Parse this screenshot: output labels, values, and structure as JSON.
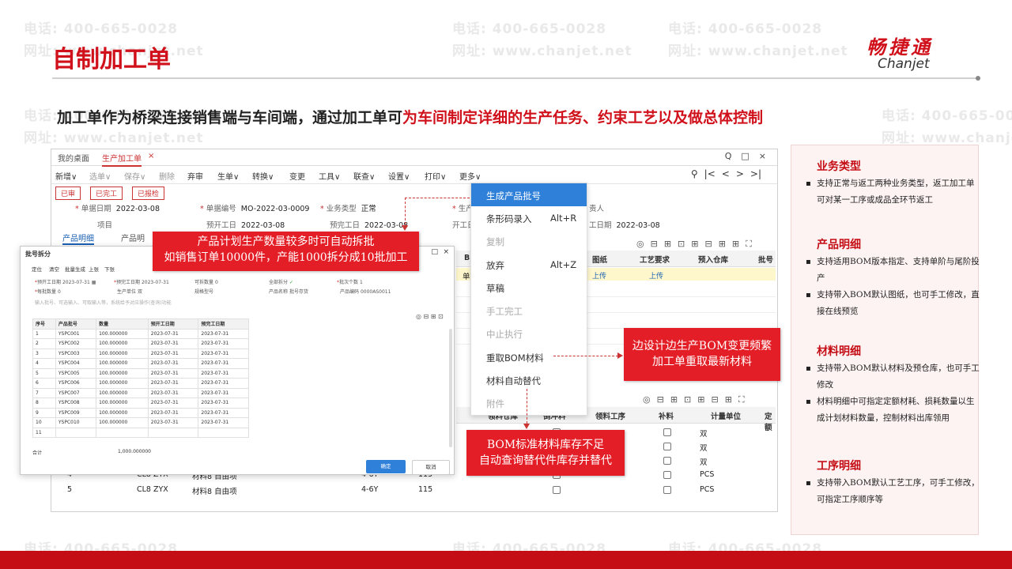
{
  "watermark": {
    "phone": "电话: 400-665-0028",
    "web": "网址: www.chanjet.net"
  },
  "slide": {
    "title": "自制加工单",
    "logo_cn": "畅捷通",
    "logo_en": "Chanjet",
    "subtitle_a": "加工单作为桥梁连接销售端与车间端，通过加工单可",
    "subtitle_b": "为车间制定详细的生产任务、约束工艺以及做总体控制"
  },
  "app": {
    "tabs": [
      "我的桌面",
      "生产加工单"
    ],
    "tab_close": "×",
    "window_tools": [
      "Q",
      "□",
      "×"
    ],
    "toolbar": [
      "新增∨",
      "选单∨",
      "保存∨",
      "删除",
      "弃审",
      "生单∨",
      "转换∨",
      "变更",
      "工具∨",
      "联查∨",
      "设置∨",
      "打印∨",
      "更多∨"
    ],
    "nav_tools": [
      "⚲",
      "|<",
      "<",
      ">",
      ">|"
    ],
    "status_buttons": [
      "已审",
      "已完工",
      "已报检"
    ],
    "form": {
      "doc_date_label": "单据日期",
      "doc_date": "2022-03-08",
      "doc_no_label": "单据编号",
      "doc_no": "MO-2022-03-0009",
      "biz_type_label": "业务类型",
      "biz_type": "正常",
      "prod_label": "生产",
      "project_label": "项目",
      "plan_start_label": "预开工日",
      "plan_start": "2022-03-08",
      "plan_finish_label": "预完工日",
      "plan_finish": "2022-03-08",
      "start_label": "开工日",
      "owner_label": "责人",
      "finish_date_label": "工日期",
      "finish_date": "2022-03-08"
    },
    "section_tabs": [
      "产品明细",
      "产品明"
    ],
    "grid_icons": [
      "◎",
      "⊟",
      "⊞",
      "⊡",
      "⊞",
      "⊟",
      "⊞",
      "⊞",
      "⛶"
    ],
    "grid_header": [
      "B",
      "图纸",
      "工艺要求",
      "预入仓库",
      "批号"
    ],
    "grid_row1_prefix": "单",
    "grid_row1_upload": [
      "上传",
      "上传"
    ],
    "grid2_header": [
      "领料仓库",
      "倒冲料",
      "领料工序",
      "补料",
      "计量单位",
      "定额"
    ],
    "grid2_units": [
      "双",
      "双",
      "双",
      "PCS",
      "PCS"
    ],
    "grid2_rows": [
      {
        "no": "4",
        "code": "CL8 ZYX",
        "name": "材料8 自由项",
        "spec": "4-6Y",
        "qty": "115"
      },
      {
        "no": "5",
        "code": "CL8 ZYX",
        "name": "材料8 自由项",
        "spec": "4-6Y",
        "qty": "115"
      }
    ]
  },
  "menu": {
    "items": [
      {
        "label": "生成产品批号",
        "key": "",
        "state": "active"
      },
      {
        "label": "条形码录入",
        "key": "Alt+R",
        "state": "normal"
      },
      {
        "label": "复制",
        "key": "",
        "state": "disabled"
      },
      {
        "label": "放弃",
        "key": "Alt+Z",
        "state": "normal"
      },
      {
        "label": "草稿",
        "key": "",
        "state": "normal"
      },
      {
        "label": "手工完工",
        "key": "",
        "state": "disabled"
      },
      {
        "label": "中止执行",
        "key": "",
        "state": "disabled"
      },
      {
        "label": "重取BOM材料",
        "key": "",
        "state": "normal"
      },
      {
        "label": "材料自动替代",
        "key": "",
        "state": "normal"
      },
      {
        "label": "附件",
        "key": "",
        "state": "disabled"
      }
    ]
  },
  "dialog": {
    "title": "批号拆分",
    "toolbar": [
      "定位",
      "清空",
      "批量生成",
      "上张",
      "下张"
    ],
    "fields": {
      "plan_start_label": "预开工日期",
      "plan_start": "2023-07-31",
      "plan_finish_label": "预完工日期",
      "plan_finish": "2023-07-31",
      "split_qty_label": "可拆数量",
      "split_qty": "0",
      "split_all_label": "全部拆分",
      "split_all": "✓",
      "batch_count_label": "批次个数",
      "batch_count": "1",
      "per_batch_label": "每批数量",
      "per_batch": "0",
      "unit_label": "生产单位",
      "unit": "双",
      "spec_label": "规格型号",
      "product_label": "产品名称",
      "product_value": "批号存货",
      "code_label": "产品编码",
      "code": "0000AS0011",
      "placeholder": "输入批号、可选输入、可取输入等，系统给予对应操作(查询)功能"
    },
    "table_header": [
      "序号",
      "产品批号",
      "数量",
      "预开工日期",
      "预完工日期"
    ],
    "rows": [
      {
        "no": "1",
        "lot": "YSPC001",
        "qty": "100.000000",
        "start": "2023-07-31",
        "end": "2023-07-31"
      },
      {
        "no": "2",
        "lot": "YSPC002",
        "qty": "100.000000",
        "start": "2023-07-31",
        "end": "2023-07-31"
      },
      {
        "no": "3",
        "lot": "YSPC003",
        "qty": "100.000000",
        "start": "2023-07-31",
        "end": "2023-07-31"
      },
      {
        "no": "4",
        "lot": "YSPC004",
        "qty": "100.000000",
        "start": "2023-07-31",
        "end": "2023-07-31"
      },
      {
        "no": "5",
        "lot": "YSPC005",
        "qty": "100.000000",
        "start": "2023-07-31",
        "end": "2023-07-31"
      },
      {
        "no": "6",
        "lot": "YSPC006",
        "qty": "100.000000",
        "start": "2023-07-31",
        "end": "2023-07-31"
      },
      {
        "no": "7",
        "lot": "YSPC007",
        "qty": "100.000000",
        "start": "2023-07-31",
        "end": "2023-07-31"
      },
      {
        "no": "8",
        "lot": "YSPC008",
        "qty": "100.000000",
        "start": "2023-07-31",
        "end": "2023-07-31"
      },
      {
        "no": "9",
        "lot": "YSPC009",
        "qty": "100.000000",
        "start": "2023-07-31",
        "end": "2023-07-31"
      },
      {
        "no": "10",
        "lot": "YSPC010",
        "qty": "100.000000",
        "start": "2023-07-31",
        "end": "2023-07-31"
      },
      {
        "no": "11",
        "lot": "",
        "qty": "",
        "start": "",
        "end": ""
      }
    ],
    "total_label": "合计",
    "total_value": "1,000.000000",
    "ok_label": "确定",
    "cancel_label": "取消"
  },
  "callouts": {
    "c1_line1": "产品计划生产数量较多时可自动拆批",
    "c1_line2": "如销售订单10000件，产能1000拆分成10批加工",
    "c2_line1": "边设计边生产BOM变更频繁",
    "c2_line2": "加工单重取最新材料",
    "c3_line1": "BOM标准材料库存不足",
    "c3_line2": "自动查询替代件库存并替代"
  },
  "panel": {
    "h1": "业务类型",
    "b1": "支持正常与返工两种业务类型，返工加工单可对某一工序或成品全环节返工",
    "h2": "产品明细",
    "b2a": "支持适用BOM版本指定、支持单阶与尾阶投产",
    "b2b": "支持带入BOM默认图纸，也可手工修改，直接在线预览",
    "h3": "材料明细",
    "b3a": "支持带入BOM默认材料及预仓库，也可手工修改",
    "b3b": "材料明细中可指定定额材耗、损耗数量以生成计划材料数量，控制材料出库领用",
    "h4": "工序明细",
    "b4": "支持带入BOM默认工艺工序，可手工修改，可指定工序顺序等"
  },
  "colors": {
    "brand_red": "#d0101a",
    "bar_red": "#c40d14",
    "menu_active": "#2f80d9",
    "callout": "#e41e26"
  }
}
